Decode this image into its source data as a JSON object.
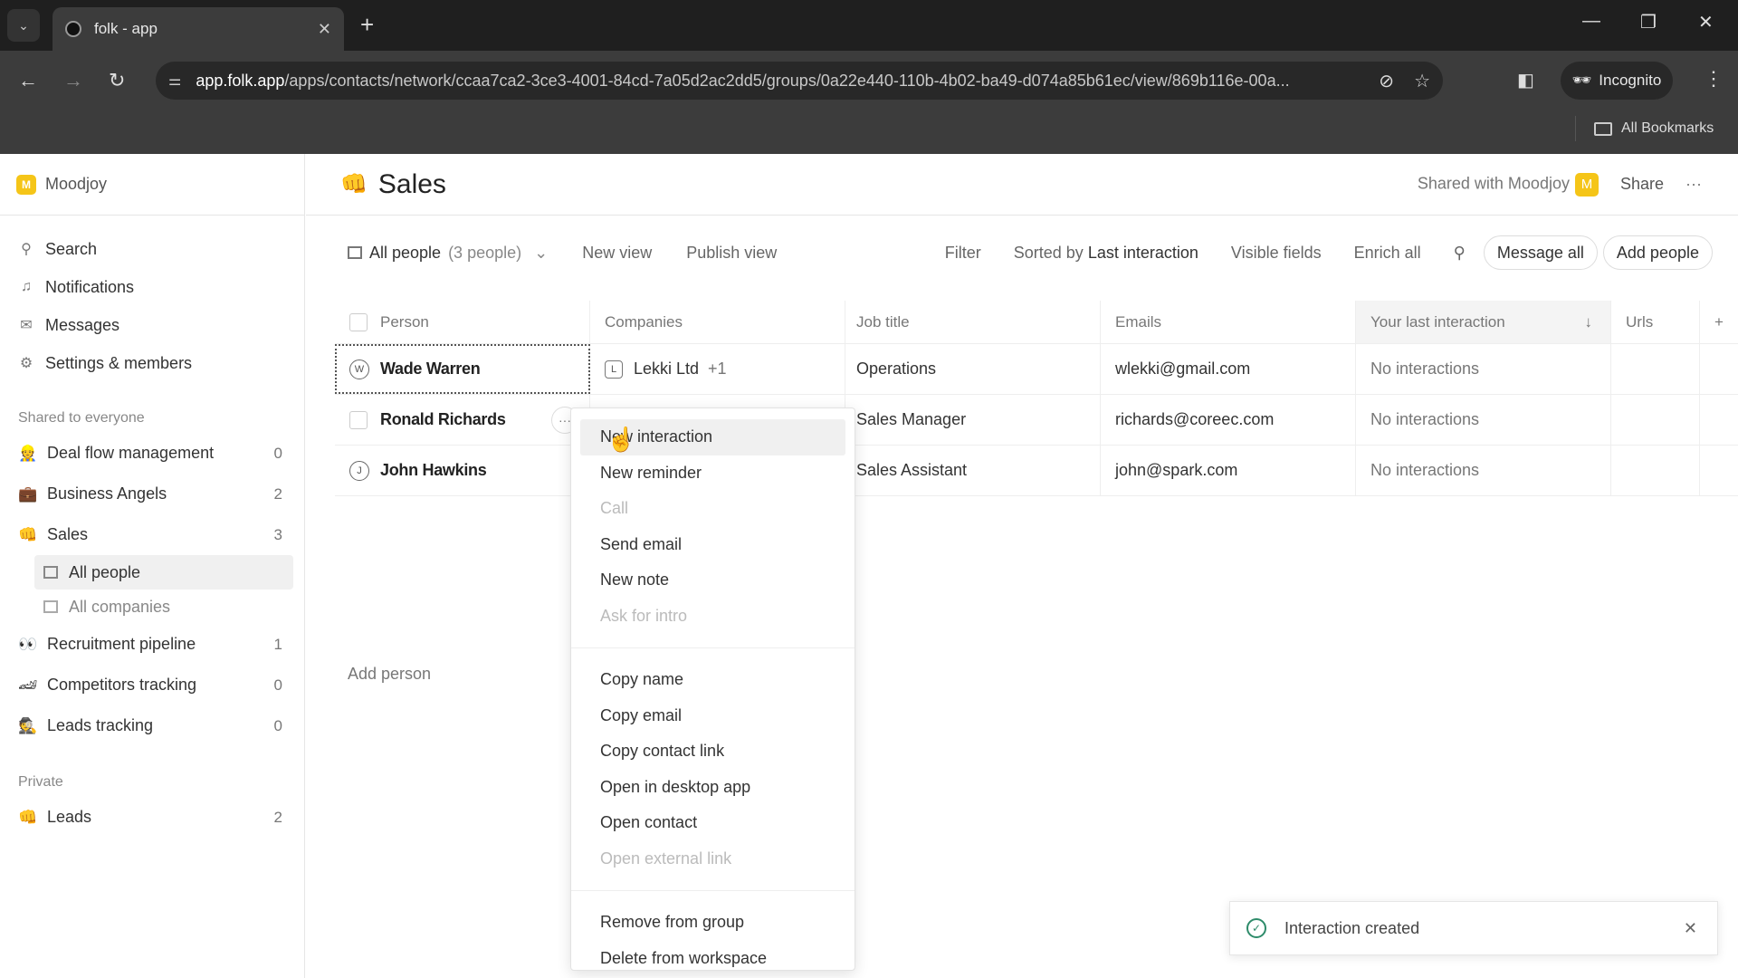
{
  "browser": {
    "tab_title": "folk - app",
    "url_host": "app.folk.app",
    "url_path": "/apps/contacts/network/ccaa7ca2-3ce3-4001-84cd-7a05d2ac2dd5/groups/0a22e440-110b-4b02-ba49-d074a85b61ec/view/869b116e-00a...",
    "incognito_label": "Incognito",
    "bookmarks_label": "All Bookmarks"
  },
  "workspace": {
    "badge": "M",
    "name": "Moodjoy"
  },
  "sidebar": {
    "nav": [
      {
        "icon": "search-icon",
        "label": "Search"
      },
      {
        "icon": "bell-icon",
        "label": "Notifications"
      },
      {
        "icon": "mail-icon",
        "label": "Messages"
      },
      {
        "icon": "gear-icon",
        "label": "Settings & members"
      }
    ],
    "shared_label": "Shared to everyone",
    "shared_groups": [
      {
        "emoji": "👷",
        "name": "Deal flow management",
        "count": "0"
      },
      {
        "emoji": "💼",
        "name": "Business Angels",
        "count": "2"
      },
      {
        "emoji": "👊",
        "name": "Sales",
        "count": "3"
      }
    ],
    "sales_views": [
      {
        "label": "All people",
        "active": true
      },
      {
        "label": "All companies",
        "active": false
      }
    ],
    "shared_groups_2": [
      {
        "emoji": "👀",
        "name": "Recruitment pipeline",
        "count": "1"
      },
      {
        "emoji": "🏎",
        "name": "Competitors tracking",
        "count": "0"
      },
      {
        "emoji": "🕵",
        "name": "Leads tracking",
        "count": "0"
      }
    ],
    "private_label": "Private",
    "private_groups": [
      {
        "emoji": "👊",
        "name": "Leads",
        "count": "2"
      }
    ]
  },
  "header": {
    "emoji": "👊",
    "title": "Sales",
    "shared_with": "Shared with Moodjoy",
    "shared_badge": "M",
    "share_label": "Share",
    "more": "···"
  },
  "viewbar": {
    "view_name": "All people",
    "view_count": "(3 people)",
    "new_view": "New view",
    "publish_view": "Publish view",
    "filter": "Filter",
    "sorted_prefix": "Sorted by",
    "sorted_field": "Last interaction",
    "visible_fields": "Visible fields",
    "enrich_all": "Enrich all",
    "message_all": "Message all",
    "add_people": "Add people"
  },
  "table": {
    "columns": [
      "Person",
      "Companies",
      "Job title",
      "Emails",
      "Your last interaction",
      "Urls"
    ],
    "rows": [
      {
        "initial": "W",
        "name": "Wade Warren",
        "company_initial": "L",
        "company": "Lekki Ltd",
        "company_more": "+1",
        "job": "Operations",
        "email": "wlekki@gmail.com",
        "last": "No interactions",
        "urls": ""
      },
      {
        "initial": "",
        "name": "Ronald Richards",
        "company_initial": "",
        "company": "",
        "company_more": "",
        "job": "Sales Manager",
        "email": "richards@coreec.com",
        "last": "No interactions",
        "urls": ""
      },
      {
        "initial": "J",
        "name": "John Hawkins",
        "company_initial": "",
        "company": "",
        "company_more": "",
        "job": "Sales Assistant",
        "email": "john@spark.com",
        "last": "No interactions",
        "urls": ""
      }
    ],
    "add_person": "Add person"
  },
  "context_menu": {
    "group1": [
      {
        "label": "New interaction",
        "disabled": false,
        "hover": true
      },
      {
        "label": "New reminder",
        "disabled": false
      },
      {
        "label": "Call",
        "disabled": true
      },
      {
        "label": "Send email",
        "disabled": false
      },
      {
        "label": "New note",
        "disabled": false
      },
      {
        "label": "Ask for intro",
        "disabled": true
      }
    ],
    "group2": [
      {
        "label": "Copy name",
        "disabled": false
      },
      {
        "label": "Copy email",
        "disabled": false
      },
      {
        "label": "Copy contact link",
        "disabled": false
      },
      {
        "label": "Open in desktop app",
        "disabled": false
      },
      {
        "label": "Open contact",
        "disabled": false
      },
      {
        "label": "Open external link",
        "disabled": true
      }
    ],
    "group3": [
      {
        "label": "Remove from group",
        "disabled": false
      },
      {
        "label": "Delete from workspace",
        "disabled": false
      }
    ]
  },
  "toast": {
    "message": "Interaction created"
  }
}
